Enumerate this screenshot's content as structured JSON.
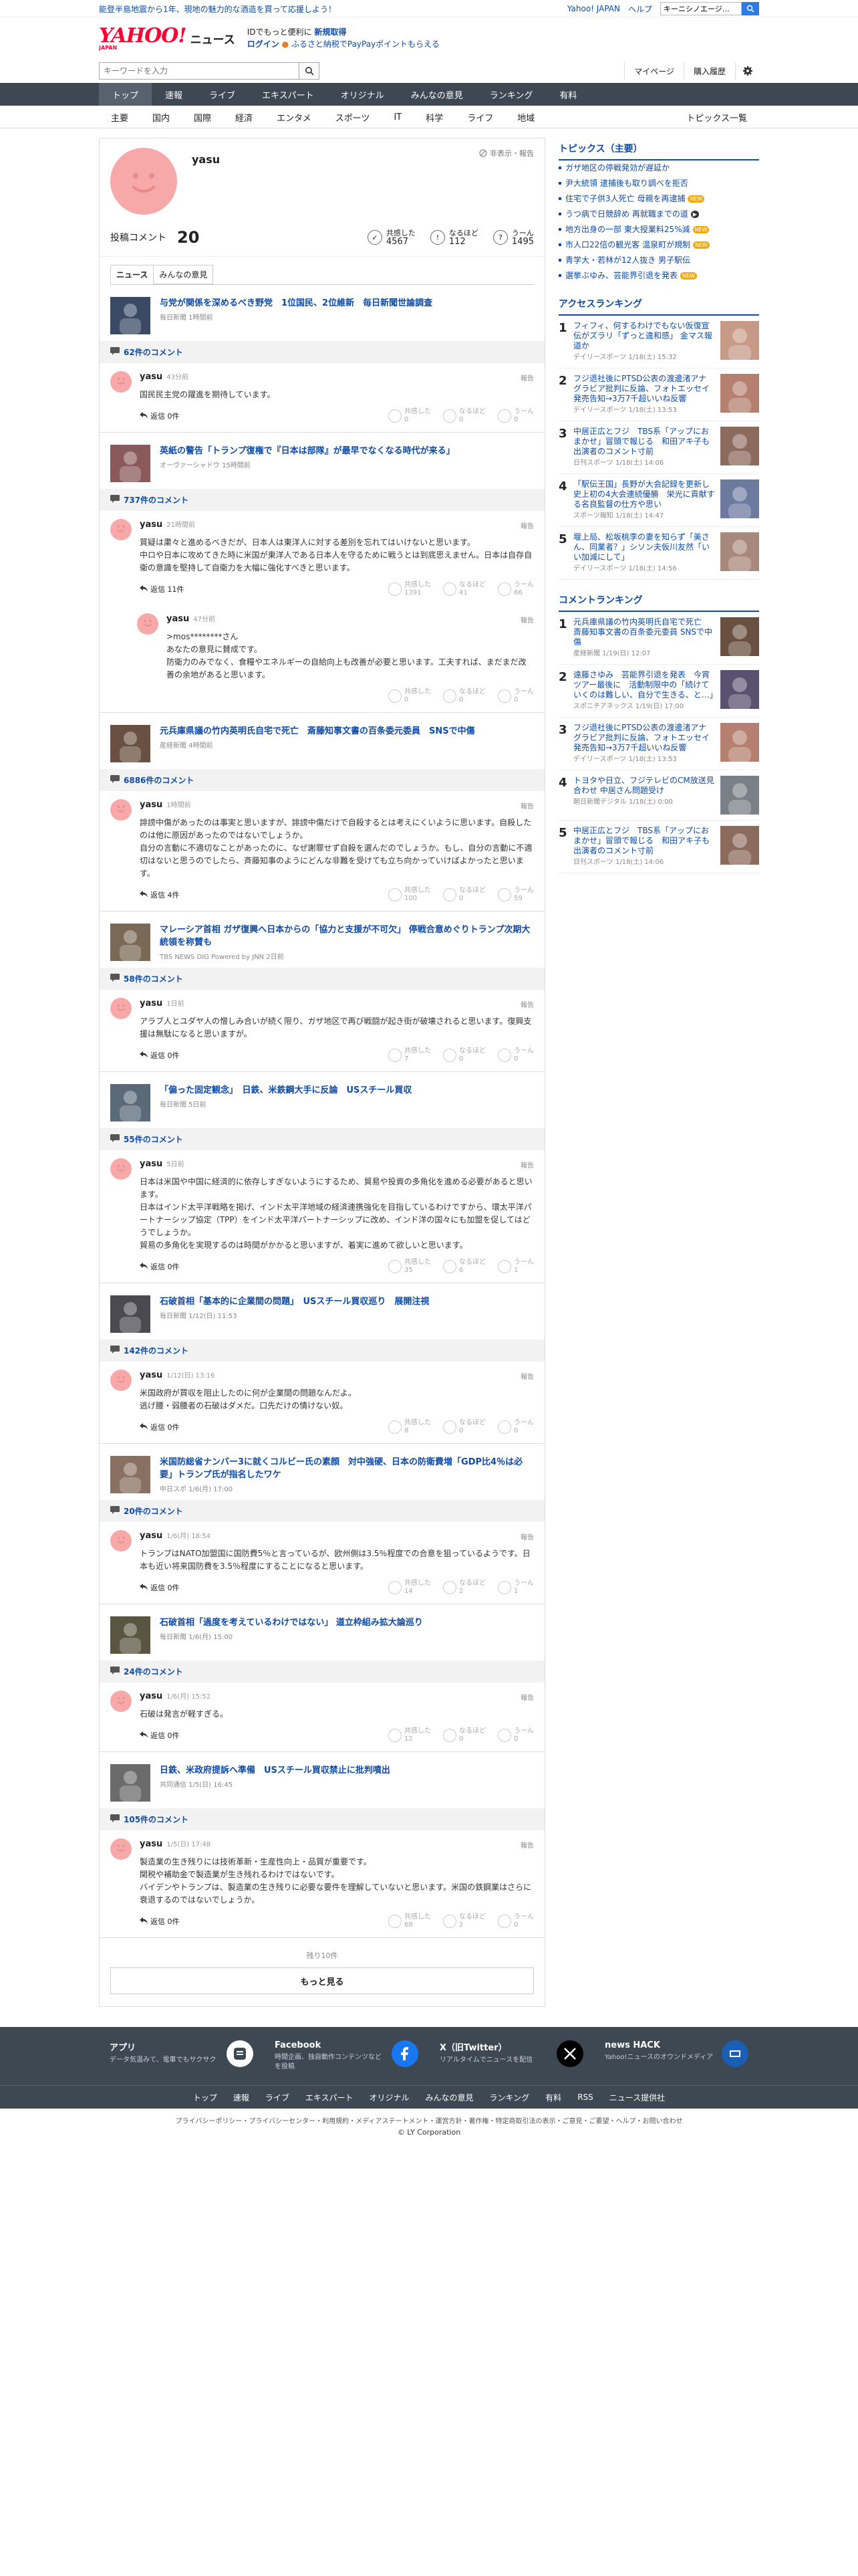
{
  "topbar": {
    "promo": "能登半島地震から1年、現地の魅力的な酒造を買って応援しよう！",
    "links": [
      "Yahoo! JAPAN",
      "ヘルプ"
    ],
    "search_placeholder": "ウェブ検索",
    "search_value": "キーニシノエージ…"
  },
  "header": {
    "logo": "YAHOO!",
    "logo_sub": "JAPAN",
    "service": "ニュース",
    "line1_a": "IDでもっと便利に",
    "line1_b": "新規取得",
    "line2_a": "ログイン",
    "line2_b": "ふるさと納税でPayPayポイントもらえる"
  },
  "search": {
    "placeholder": "キーワードを入力",
    "mypage": "マイページ",
    "history": "購入履歴"
  },
  "nav": [
    "トップ",
    "速報",
    "ライブ",
    "エキスパート",
    "オリジナル",
    "みんなの意見",
    "ランキング",
    "有料"
  ],
  "subnav": [
    "主要",
    "国内",
    "国際",
    "経済",
    "エンタメ",
    "スポーツ",
    "IT",
    "科学",
    "ライフ",
    "地域"
  ],
  "subnav_right": "トピックス一覧",
  "profile": {
    "name": "yasu",
    "flag": "非表示・報告",
    "count_label": "投稿コメント",
    "count": "20",
    "stats": [
      {
        "label": "共感した",
        "value": "4567"
      },
      {
        "label": "なるほど",
        "value": "112"
      },
      {
        "label": "うーん",
        "value": "1495"
      }
    ],
    "tabs": [
      "ニュース",
      "みんなの意見"
    ]
  },
  "labels": {
    "report": "報告",
    "reply": "返信",
    "empathy": "共感した",
    "naruhodo": "なるほど",
    "uun": "うーん"
  },
  "articles": [
    {
      "title": "与党が関係を深めるべき野党　1位国民、2位維新　毎日新聞世論調査",
      "source": "毎日新聞 1時間前",
      "comment_count": "62件のコメント",
      "thumb": "#3a4a66",
      "comments": [
        {
          "user": "yasu",
          "time": "43分前",
          "text": [
            "国民民主党の躍進を期待しています。"
          ],
          "replies": "返信 0件",
          "r": [
            "0",
            "0",
            "0"
          ],
          "reply": false
        }
      ]
    },
    {
      "title": "英紙の警告「トランプ復権で『日本は部隊』が最早でなくなる時代が来る」",
      "source": "オーヴァーシャドウ 15時間前",
      "comment_count": "737件のコメント",
      "thumb": "#8a5a5a",
      "comments": [
        {
          "user": "yasu",
          "time": "21時間前",
          "text": [
            "質疑は粛々と進めるべきだが、日本人は東洋人に対する差別を忘れてはいけないと思います。",
            "中ロや日本に攻めてきた時に米国が東洋人である日本人を守るために戦うとは到底思えません。日本は自存自衛の意識を堅持して自衛力を大幅に強化すべきと思います。"
          ],
          "replies": "返信 11件",
          "r": [
            "1391",
            "41",
            "66"
          ],
          "reply": false
        },
        {
          "user": "yasu",
          "time": "47分前",
          "text": [
            ">mos********さん",
            "あなたの意見に賛成です。",
            "防衛力のみでなく、食糧やエネルギーの自給向上も改善が必要と思います。工夫すれば、まだまだ改善の余地があると思います。"
          ],
          "replies": "",
          "r": [
            "0",
            "0",
            "0"
          ],
          "reply": true
        }
      ]
    },
    {
      "title": "元兵庫県議の竹内英明氏自宅で死亡　斎藤知事文書の百条委元委員　SNSで中傷",
      "source": "産経新聞 4時間前",
      "comment_count": "6886件のコメント",
      "thumb": "#6a5040",
      "comments": [
        {
          "user": "yasu",
          "time": "1時間前",
          "text": [
            "誹謗中傷があったのは事実と思いますが、誹謗中傷だけで自殺するとは考えにくいように思います。自殺したのは他に原因があったのではないでしょうか。",
            "自分の言動に不適切なことがあったのに、なぜ謝罪せず自殺を選んだのでしょうか。もし、自分の言動に不適切はないと思うのでしたら、斉藤知事のようにどんな非難を受けても立ち向かっていけばよかったと思います。"
          ],
          "replies": "返信 4件",
          "r": [
            "100",
            "0",
            "59"
          ],
          "reply": false
        }
      ]
    },
    {
      "title": "マレーシア首相 ガザ復興へ日本からの「協力と支援が不可欠」 停戦合意めぐりトランプ次期大統領を称賛も",
      "source": "TBS NEWS DIG Powered by JNN 2日前",
      "comment_count": "58件のコメント",
      "thumb": "#7a6a55",
      "comments": [
        {
          "user": "yasu",
          "time": "1日前",
          "text": [
            "アラブ人とユダヤ人の憎しみ合いが続く限り、ガザ地区で再び戦闘が起き街が破壊されると思います。復興支援は無駄になると思いますが。"
          ],
          "replies": "返信 0件",
          "r": [
            "7",
            "0",
            "0"
          ],
          "reply": false
        }
      ]
    },
    {
      "title": "「偏った固定観念」　日鉄、米鉄鋼大手に反論　USスチール買収",
      "source": "毎日新聞 5日前",
      "comment_count": "55件のコメント",
      "thumb": "#5a6a78",
      "comments": [
        {
          "user": "yasu",
          "time": "5日前",
          "text": [
            "日本は米国や中国に経済的に依存しすぎないようにするため、貿易や投資の多角化を進める必要があると思います。",
            "日本はインド太平洋戦略を掲げ、インド太平洋地域の経済連携強化を目指しているわけですから、環太平洋パートナーシップ協定（TPP）をインド太平洋パートナーシップに改め、インド洋の国々にも加盟を促してはどうでしょうか。",
            "貿易の多角化を実現するのは時間がかかると思いますが、着実に進めて欲しいと思います。"
          ],
          "replies": "返信 0件",
          "r": [
            "35",
            "6",
            "1"
          ],
          "reply": false
        }
      ]
    },
    {
      "title": "石破首相「基本的に企業間の問題」　USスチール買収巡り　展開注視",
      "source": "毎日新聞 1/12(日) 11:53",
      "comment_count": "142件のコメント",
      "thumb": "#4a4a50",
      "comments": [
        {
          "user": "yasu",
          "time": "1/12(日) 13:16",
          "text": [
            "米国政府が買収を阻止したのに何が企業間の問題なんだよ。",
            "逃げ腰・弱腰者の石破はダメだ。口先だけの情けない奴。"
          ],
          "replies": "返信 0件",
          "r": [
            "8",
            "0",
            "0"
          ],
          "reply": false
        }
      ]
    },
    {
      "title": "米国防総省ナンバー3に就くコルビー氏の素顔　対中強硬、日本の防衛費増「GDP比4％は必要」トランプ氏が指名したワケ",
      "source": "中日スポ 1/6(月) 17:00",
      "comment_count": "20件のコメント",
      "thumb": "#8a7060",
      "comments": [
        {
          "user": "yasu",
          "time": "1/6(月) 18:54",
          "text": [
            "トランプはNATO加盟国に国防費5％と言っているが、欧州側は3.5％程度での合意を狙っているようです。日本も近い将来国防費を3.5％程度にすることになると思います。"
          ],
          "replies": "返信 0件",
          "r": [
            "14",
            "2",
            "1"
          ],
          "reply": false
        }
      ]
    },
    {
      "title": "石破首相「過度を考えているわけではない」 道立枠組み拡大論巡り",
      "source": "毎日新聞 1/6(月) 15:00",
      "comment_count": "24件のコメント",
      "thumb": "#5a5540",
      "comments": [
        {
          "user": "yasu",
          "time": "1/6(月) 15:52",
          "text": [
            "石破は発言が軽すぎる。"
          ],
          "replies": "返信 0件",
          "r": [
            "12",
            "0",
            "0"
          ],
          "reply": false
        }
      ]
    },
    {
      "title": "日鉄、米政府提訴へ準備　USスチール買収禁止に批判噴出",
      "source": "共同通信 1/5(日) 16:45",
      "comment_count": "105件のコメント",
      "thumb": "#6b6b6b",
      "comments": [
        {
          "user": "yasu",
          "time": "1/5(日) 17:48",
          "text": [
            "製造業の生き残りには技術革新・生産性向上・品質が重要です。",
            "関税や補助金で製造業が生き残れるわけではないです。",
            "バイデンやトランプは、製造業の生き残りに必要な要件を理解していないと思います。米国の鉄鋼業はさらに衰退するのではないでしょうか。"
          ],
          "replies": "返信 0件",
          "r": [
            "68",
            "2",
            "0"
          ],
          "reply": false
        }
      ]
    }
  ],
  "more": {
    "remaining": "残り10件",
    "button": "もっと見る"
  },
  "sidebar": {
    "topics_title": "トピックス（主要）",
    "topics": [
      {
        "text": "ガザ地区の停戦発効が遅延か",
        "badge": ""
      },
      {
        "text": "尹大統領 逮捕後も取り調べを拒否",
        "badge": ""
      },
      {
        "text": "住宅で子供3人死亡 母親を再逮捕",
        "badge": "NEW"
      },
      {
        "text": "うつ病で日競辞め 再就職までの道",
        "badge": "▶"
      },
      {
        "text": "地方出身の一部 東大授業料25%減",
        "badge": "NEW"
      },
      {
        "text": "市人口22倍の観光客 温泉町が規制",
        "badge": "NEW"
      },
      {
        "text": "青学大・若林が12人抜き 男子駅伝",
        "badge": ""
      },
      {
        "text": "選挙ぶゆみ、芸能界引退を発表",
        "badge": "NEW"
      }
    ],
    "access_title": "アクセスランキング",
    "access": [
      {
        "n": "1",
        "text": "フィフィ、何するわけでもない仮復宣伝がズラリ「ずっと違和感」 金マス報道か",
        "src": "デイリースポーツ 1/18(土) 15:32",
        "thumb": "#c79a88"
      },
      {
        "n": "2",
        "text": "フジ退社後にPTSD公表の渡邊渚アナ　グラビア批判に反論、フォトエッセイ発売告知→3万7千超いいね反響",
        "src": "デイリースポーツ 1/18(土) 13:53",
        "thumb": "#b58070"
      },
      {
        "n": "3",
        "text": "中居正広とフジ　TBS系「アップにおまかせ」冒頭で報じる　和田アキ子も出演者のコメント寸前",
        "src": "日刊スポーツ 1/18(土) 14:06",
        "thumb": "#8c6a5c"
      },
      {
        "n": "4",
        "text": "「駅伝王国」長野が大会記録を更新し史上初の4大会連続優勝　栄光に貢献する名良監督の仕方や思い",
        "src": "スポーツ報知 1/18(土) 14:47",
        "thumb": "#6c7aa0"
      },
      {
        "n": "5",
        "text": "堰上局、松坂桃李の妻を知らず「美さん、同業者？」シソン夫仮川友然「いい加減にして」",
        "src": "デイリースポーツ 1/18(土) 14:56",
        "thumb": "#a8887a"
      }
    ],
    "comment_title": "コメントランキング",
    "comment": [
      {
        "n": "1",
        "text": "元兵庫県議の竹内英明氏自宅で死亡　斎藤知事文書の百条委元委員 SNSで中傷",
        "src": "産経新聞 1/19(日) 12:07",
        "thumb": "#6a5040"
      },
      {
        "n": "2",
        "text": "遠藤さゆみ　芸能界引退を発表　今宵ツアー最後に　活動制限中の「続けていくのは難しい、自分で生きる、と…」",
        "src": "スポニチアネックス 1/19(日) 17:00",
        "thumb": "#5a5070"
      },
      {
        "n": "3",
        "text": "フジ退社後にPTSD公表の渡邊渚アナ　グラビア批判に反論、フォトエッセイ発売告知→3万7千超いいね反響",
        "src": "デイリースポーツ 1/18(土) 13:53",
        "thumb": "#b58070"
      },
      {
        "n": "4",
        "text": "トヨタや日立、フジテレビのCM放送見合わせ 中居さん問題受け",
        "src": "朝日新聞デジタル 1/18(土) 0:00",
        "thumb": "#7a8088"
      },
      {
        "n": "5",
        "text": "中居正広とフジ　TBS系「アップにおまかせ」冒頭で報じる　和田アキ子も出演者のコメント寸前",
        "src": "日刊スポーツ 1/18(土) 14:06",
        "thumb": "#8c6a5c"
      }
    ]
  },
  "footer": {
    "boxes": [
      {
        "title": "アプリ",
        "desc": "データ気温みて、電車でもサクサク",
        "color": "#ffffff"
      },
      {
        "title": "Facebook",
        "desc": "時間企画、独自動作コンテンツなどを投稿",
        "color": "#1877f2"
      },
      {
        "title": "X（旧Twitter）",
        "desc": "リアルタイムでニュースを配信",
        "color": "#000000"
      },
      {
        "title": "news HACK",
        "desc": "Yahoo!ニュースのオウンドメディア",
        "color": "#1a5fb4"
      }
    ],
    "links": [
      "トップ",
      "速報",
      "ライブ",
      "エキスパート",
      "オリジナル",
      "みんなの意見",
      "ランキング",
      "有料",
      "RSS",
      "ニュース提供社"
    ],
    "legal": "プライバシーポリシー・プライバシーセンター・利用規約・メディアステートメント・運営方針・著作権・特定商取引法の表示・ご意見・ご要望・ヘルプ・お問い合わせ",
    "copyright": "© LY Corporation"
  }
}
